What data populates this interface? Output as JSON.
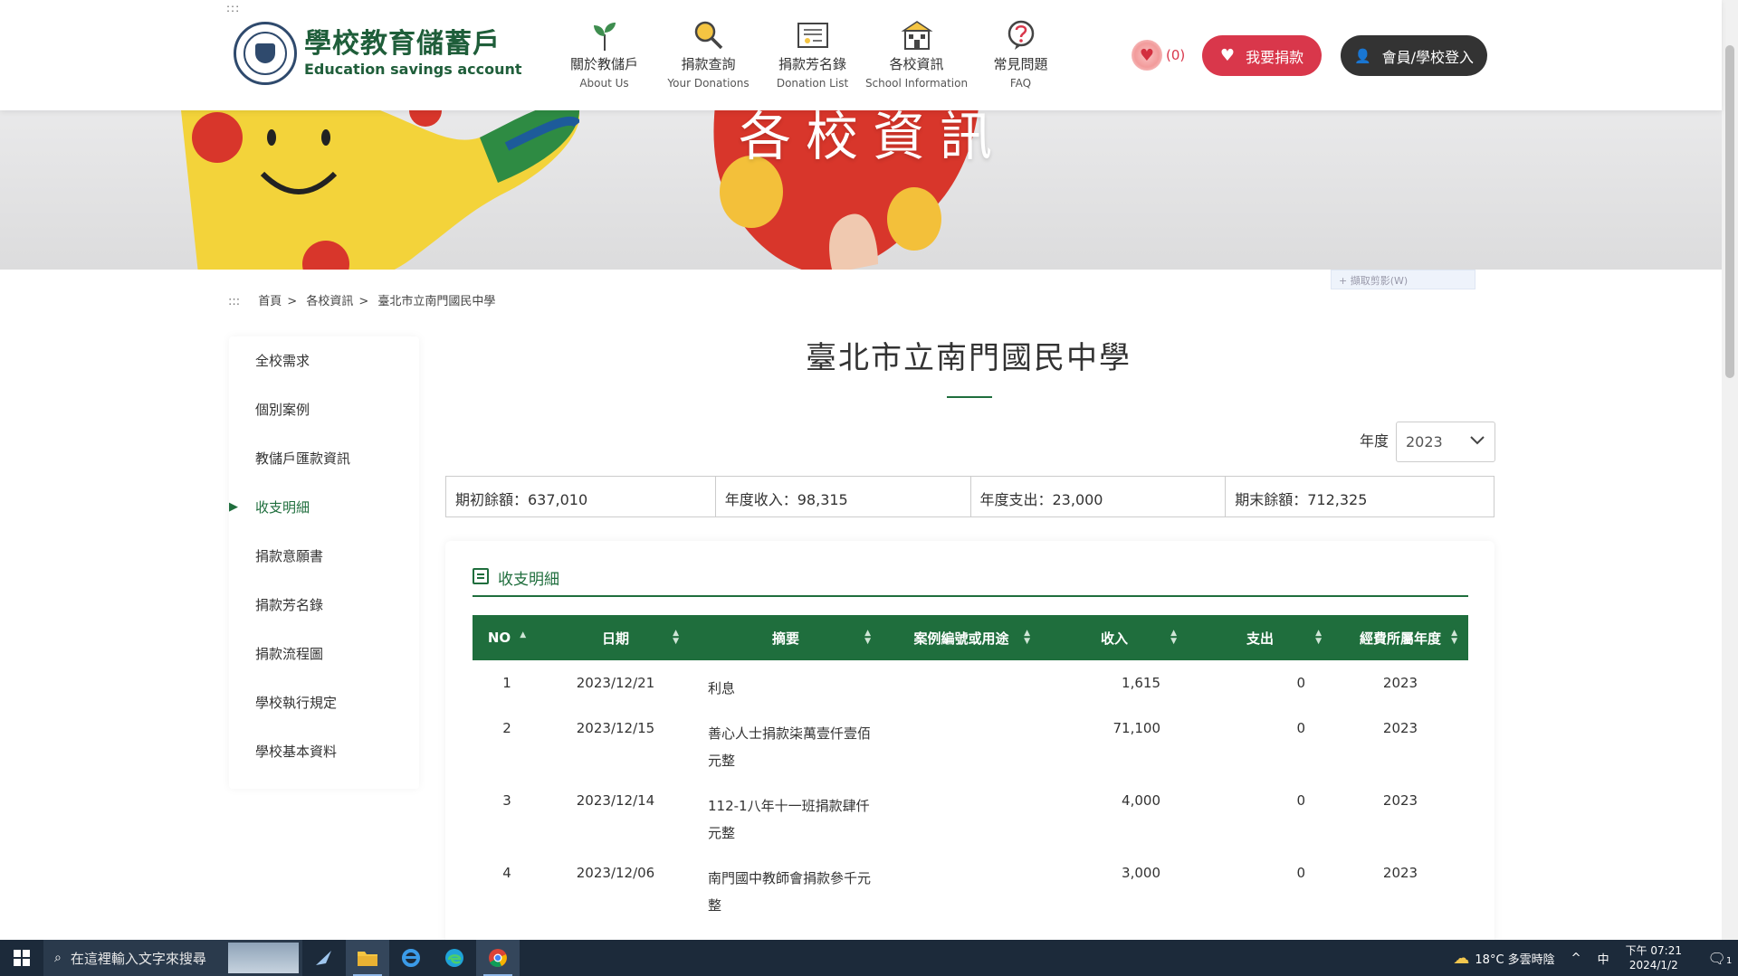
{
  "header": {
    "access_key": ":::",
    "logo_zh": "學校教育儲蓄戶",
    "logo_en": "Education savings account",
    "nav": [
      {
        "zh": "關於教儲戶",
        "en": "About Us",
        "icon": "sprout-icon"
      },
      {
        "zh": "捐款查詢",
        "en": "Your Donations",
        "icon": "magnifier-icon"
      },
      {
        "zh": "捐款芳名錄",
        "en": "Donation List",
        "icon": "certificate-icon"
      },
      {
        "zh": "各校資訊",
        "en": "School Information",
        "icon": "school-icon"
      },
      {
        "zh": "常見問題",
        "en": "FAQ",
        "icon": "question-icon"
      }
    ],
    "favorite_count": "(0)",
    "donate_label": "我要捐款",
    "login_label": "會員/學校登入"
  },
  "banner": {
    "title": "各校資訊"
  },
  "breadcrumb": {
    "access_key": ":::",
    "items": [
      "首頁",
      "各校資訊",
      "臺北市立南門國民中學"
    ],
    "sep": ">"
  },
  "overlay_select": "+ 擷取剪影(W)",
  "sidebar": {
    "items": [
      "全校需求",
      "個別案例",
      "教儲戶匯款資訊",
      "收支明細",
      "捐款意願書",
      "捐款芳名錄",
      "捐款流程圖",
      "學校執行規定",
      "學校基本資料"
    ],
    "active_index": 3
  },
  "main": {
    "title": "臺北市立南門國民中學",
    "year_label": "年度",
    "year_value": "2023",
    "summary": [
      "期初餘額：637,010",
      "年度收入：98,315",
      "年度支出：23,000",
      "期末餘額：712,325"
    ],
    "panel_title": "收支明細",
    "table": {
      "headers": [
        "NO",
        "日期",
        "摘要",
        "案例編號或用途",
        "收入",
        "支出",
        "經費所屬年度"
      ],
      "rows": [
        [
          "1",
          "2023/12/21",
          "利息",
          "",
          "1,615",
          "0",
          "2023"
        ],
        [
          "2",
          "2023/12/15",
          "善心人士捐款柒萬壹仟壹佰元整",
          "",
          "71,100",
          "0",
          "2023"
        ],
        [
          "3",
          "2023/12/14",
          "112-1八年十一班捐款肆仟元整",
          "",
          "4,000",
          "0",
          "2023"
        ],
        [
          "4",
          "2023/12/06",
          "南門國中教師會捐款參千元整",
          "",
          "3,000",
          "0",
          "2023"
        ]
      ]
    }
  },
  "taskbar": {
    "search_placeholder": "在這裡輸入文字來搜尋",
    "weather": "18°C 多雲時陰",
    "ime": "中",
    "time": "下午 07:21",
    "date": "2024/1/2",
    "notif_count": "1"
  },
  "colors": {
    "brand_green": "#1f6e3d",
    "donate_red": "#d9374b",
    "login_dark": "#333333"
  }
}
